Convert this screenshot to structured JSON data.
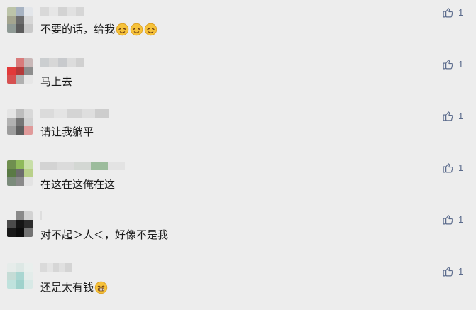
{
  "comments": [
    {
      "text": "不要的话，给我",
      "emojis": [
        "smirk-face",
        "smirk-face",
        "smirk-face"
      ],
      "likes": "1",
      "like_icon": "thumbs-up-icon",
      "avatar_colors": [
        "#bcc4a9",
        "#a7b3c2",
        "#e3e6ea",
        "#a4a58f",
        "#6b6b6b",
        "#d7d7d7",
        "#8f9a95",
        "#5c5c5c",
        "#c9c9c9"
      ],
      "nick_colors": [
        "#d6d6d6",
        "#e5e5e5",
        "#cfcfcf",
        "#e0e0e0",
        "#d2d2d2"
      ]
    },
    {
      "text": "马上去",
      "emojis": [],
      "likes": "1",
      "like_icon": "thumbs-up-icon",
      "avatar_colors": [
        "#ededed",
        "#d97b7b",
        "#c9b8b8",
        "#e23a3a",
        "#b53a3a",
        "#8d8d8d",
        "#d65151",
        "#b0b0b0",
        "#e6e6e6"
      ],
      "nick_colors": [
        "#c6c9cc",
        "#d4d4d4",
        "#c2c5c8",
        "#dadada",
        "#cccccc"
      ]
    },
    {
      "text": "请让我躺平",
      "emojis": [],
      "likes": "1",
      "like_icon": "thumbs-up-icon",
      "avatar_colors": [
        "#e4e4e4",
        "#bdbdbd",
        "#d8d8d8",
        "#b2b2b2",
        "#767676",
        "#d1d1d1",
        "#9d9d9d",
        "#5f5f5f",
        "#e09a9a"
      ],
      "nick_colors": [
        "#d9d9d9",
        "#e3e3e3",
        "#d0d0d0",
        "#dcdcdc",
        "#c8c8c8"
      ]
    },
    {
      "text": "在这在这俺在这",
      "emojis": [],
      "likes": "1",
      "like_icon": "thumbs-up-icon",
      "avatar_colors": [
        "#6f8f4f",
        "#8fba5a",
        "#c8dfa8",
        "#5a7a45",
        "#6c6c6c",
        "#b9d08a",
        "#7b8b7b",
        "#8a8a8a",
        "#e3e3e3"
      ],
      "nick_colors": [
        "#cfcfcf",
        "#d9d9d9",
        "#cfd4cf",
        "#8fb48f",
        "#e2e2e2"
      ]
    },
    {
      "text": "对不起＞人＜，好像不是我",
      "emojis": [],
      "likes": "1",
      "like_icon": "thumbs-up-icon",
      "avatar_colors": [
        "#ededed",
        "#8a8a8a",
        "#d2d2d2",
        "#4b4b4b",
        "#151515",
        "#2c2c2c",
        "#191919",
        "#0d0d0d",
        "#737373"
      ],
      "nick_colors": [
        "#dcdcdc",
        "#ededed",
        "#ededed",
        "#ededed",
        "#ededed"
      ]
    },
    {
      "text": "还是太有钱",
      "emojis": [
        "grin-face"
      ],
      "likes": "1",
      "like_icon": "thumbs-up-icon",
      "avatar_colors": [
        "#e6ecea",
        "#dde8e5",
        "#e9efed",
        "#c5dcd6",
        "#a9d6d1",
        "#e3ecea",
        "#bfe2dd",
        "#9fd2cc",
        "#d8e9e6"
      ],
      "nick_colors": [
        "#d7d7d7",
        "#e3e3e3",
        "#d3d3d3",
        "#dedede",
        "#d0d0d0"
      ]
    }
  ]
}
